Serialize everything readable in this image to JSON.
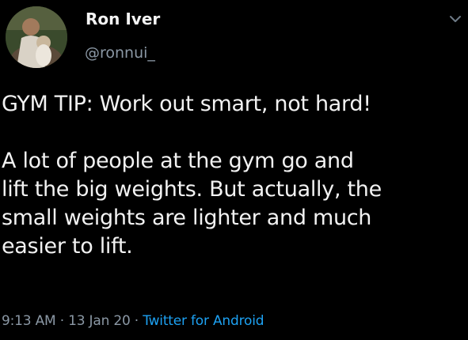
{
  "tweet": {
    "author_name": "Ron Iver",
    "author_handle": "@ronnui_",
    "paragraphs": [
      "GYM TIP: Work out smart, not hard!",
      "A lot of people at the gym go and\nlift the big weights. But actually, the\nsmall weights are lighter and much\neasier to lift."
    ],
    "time": "9:13 AM",
    "separator": " · ",
    "date": "13 Jan 20",
    "source": "Twitter for Android"
  },
  "icons": {
    "more": "chevron-down-icon"
  },
  "colors": {
    "background": "#000000",
    "text": "#f2f2f2",
    "secondary": "#8b98a5",
    "link": "#1da1f2"
  }
}
